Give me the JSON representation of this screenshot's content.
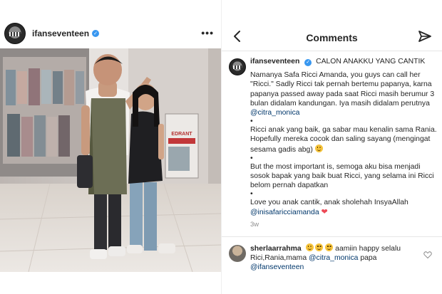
{
  "post": {
    "username": "ifanseventeen",
    "verified_badge": "✓",
    "more_icon": "more-horizontal-icon",
    "more_label": "•••",
    "photo": {
      "sign_text": "EDRANT",
      "description_icon": "photo-image"
    }
  },
  "comments_panel": {
    "title": "Comments",
    "back_icon": "chevron-left-icon",
    "send_icon": "paper-plane-icon"
  },
  "caption": {
    "username": "ifanseventeen",
    "verified_badge": "✓",
    "title": "CALON ANAKKU YANG CANTIK",
    "p1_text": "Namanya Safa Ricci Amanda, you guys can call her \"Ricci.\" Sadly Ricci tak pernah bertemu papanya, karna papanya passed away pada saat Ricci masih berumur 3 bulan didalam kandungan. Iya masih didalam perutnya ",
    "p1_mention": "@citra_monica",
    "bullet": "•",
    "p2_text": "Ricci anak yang baik, ga sabar mau kenalin sama Rania. Hopefully mereka cocok dan saling sayang (mengingat sesama gadis abg) ",
    "p3_text": "But the most important is, semoga aku bisa menjadi sosok bapak yang baik buat Ricci, yang selama ini Ricci belom pernah dapatkan",
    "p4_text": "Love you anak cantik, anak sholehah InsyaAllah",
    "p4_mention": "@inisafaricciamanda",
    "heart": "❤",
    "time_ago": "3w"
  },
  "reply": {
    "username": "sherlaarrahma",
    "text_after_emoji": " aamiin happy selalu Rici,Rania,mama ",
    "mention1": "@citra_monica",
    "text_mid": " papa ",
    "mention2": "@ifanseventeen",
    "like_icon": "heart-outline-icon"
  },
  "colors": {
    "verified": "#3897f0",
    "mention": "#00376b",
    "heart": "#ed4956",
    "secondary_text": "#8e8e8e"
  }
}
